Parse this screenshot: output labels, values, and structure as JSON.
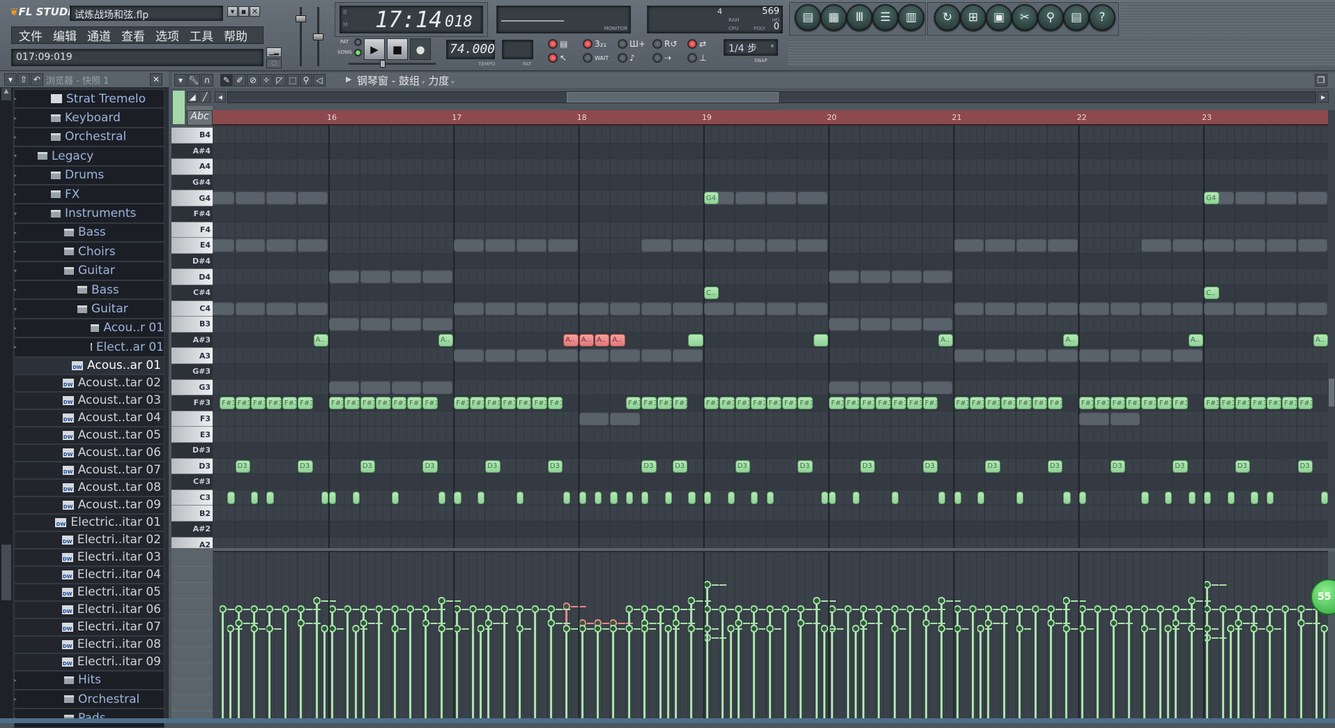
{
  "app": {
    "logo": "FL STUDIO",
    "title": "试炼战场和弦.flp"
  },
  "menu": [
    "文件",
    "编辑",
    "通道",
    "查看",
    "选项",
    "工具",
    "帮助"
  ],
  "hint": "017:09:019",
  "transport": {
    "time_main": "17:14",
    "time_sub": "018",
    "time_labels": [
      "B",
      "M"
    ],
    "monitor_label": "MONITOR",
    "pat_label": "PAT",
    "song_label": "SONG",
    "mode": "SONG",
    "tempo": "74.000",
    "tempo_label": "TEMPO",
    "pat_label2": "PAT"
  },
  "meters": {
    "value1": "4",
    "ram": "569",
    "ram_label": "RAM",
    "hd_label": "HD",
    "cpu_label": "CPU",
    "poly_label": "POLY",
    "poly": "0"
  },
  "toggles": {
    "row1": [
      {
        "icon": "pattern-icon",
        "glyph": "▤",
        "led": "red"
      },
      {
        "icon": "countdown-icon",
        "glyph": "3₂₁",
        "led": "red"
      },
      {
        "icon": "step-edit-icon",
        "glyph": "Ш+",
        "led": "off"
      },
      {
        "icon": "loop-record-icon",
        "glyph": "R↺",
        "led": "off"
      },
      {
        "icon": "blend-icon",
        "glyph": "⇄",
        "led": "red"
      }
    ],
    "row2": [
      {
        "icon": "metronome-icon",
        "glyph": "↖",
        "led": "red"
      },
      {
        "icon": "wait-icon",
        "glyph": "WAIT",
        "led": "off"
      },
      {
        "icon": "note-icon",
        "glyph": "♪",
        "led": "off"
      },
      {
        "icon": "scroll-icon",
        "glyph": "⇢",
        "led": "off"
      },
      {
        "icon": "typing-icon",
        "glyph": "⊥",
        "led": "off"
      }
    ]
  },
  "snap": {
    "value": "1/4 步",
    "label": "SNAP"
  },
  "window_buttons": [
    {
      "icon": "playlist-icon",
      "glyph": "▤"
    },
    {
      "icon": "step-sequencer-icon",
      "glyph": "▦"
    },
    {
      "icon": "piano-roll-icon",
      "glyph": "Ⅲ"
    },
    {
      "icon": "browser-icon",
      "glyph": "☰"
    },
    {
      "icon": "mixer-icon",
      "glyph": "▥"
    }
  ],
  "file_buttons": [
    {
      "icon": "undo-icon",
      "glyph": "↻"
    },
    {
      "icon": "save-new-icon",
      "glyph": "⊞"
    },
    {
      "icon": "save-icon",
      "glyph": "▣"
    },
    {
      "icon": "cut-icon",
      "glyph": "✂"
    },
    {
      "icon": "search-icon",
      "glyph": "⚲"
    },
    {
      "icon": "document-icon",
      "glyph": "▤"
    },
    {
      "icon": "help-icon",
      "glyph": "?"
    }
  ],
  "browser": {
    "title": "浏览器 - 快照 1",
    "items": [
      {
        "label": "Strat Tremelo",
        "type": "sample",
        "level": 2
      },
      {
        "label": "Keyboard",
        "type": "folder",
        "level": 2
      },
      {
        "label": "Orchestral",
        "type": "folder",
        "level": 2
      },
      {
        "label": "Legacy",
        "type": "folder",
        "level": 1,
        "open": true
      },
      {
        "label": "Drums",
        "type": "folder",
        "level": 2
      },
      {
        "label": "FX",
        "type": "folder",
        "level": 2
      },
      {
        "label": "Instruments",
        "type": "folder",
        "level": 2,
        "open": true
      },
      {
        "label": "Bass",
        "type": "folder",
        "level": 3
      },
      {
        "label": "Choirs",
        "type": "folder",
        "level": 3
      },
      {
        "label": "Guitar",
        "type": "folder",
        "level": 3,
        "open": true
      },
      {
        "label": "Bass",
        "type": "folder",
        "level": 4
      },
      {
        "label": "Guitar",
        "type": "folder",
        "level": 4,
        "open": true
      },
      {
        "label": "Acou..r 01",
        "type": "folder",
        "level": 5
      },
      {
        "label": "Elect..ar 01",
        "type": "folder",
        "level": 5
      },
      {
        "label": "Acous..ar 01",
        "type": "file",
        "selected": true
      },
      {
        "label": "Acoust..tar 02",
        "type": "file"
      },
      {
        "label": "Acoust..tar 03",
        "type": "file"
      },
      {
        "label": "Acoust..tar 04",
        "type": "file"
      },
      {
        "label": "Acoust..tar 05",
        "type": "file"
      },
      {
        "label": "Acoust..tar 06",
        "type": "file"
      },
      {
        "label": "Acoust..tar 07",
        "type": "file"
      },
      {
        "label": "Acoust..tar 08",
        "type": "file"
      },
      {
        "label": "Acoust..tar 09",
        "type": "file"
      },
      {
        "label": "Electric..itar 01",
        "type": "file"
      },
      {
        "label": "Electri..itar 02",
        "type": "file"
      },
      {
        "label": "Electri..itar 03",
        "type": "file"
      },
      {
        "label": "Electri..itar 04",
        "type": "file"
      },
      {
        "label": "Electri..itar 05",
        "type": "file"
      },
      {
        "label": "Electri..itar 06",
        "type": "file"
      },
      {
        "label": "Electri..itar 07",
        "type": "file"
      },
      {
        "label": "Electri..itar 08",
        "type": "file"
      },
      {
        "label": "Electri..itar 09",
        "type": "file"
      },
      {
        "label": "Hits",
        "type": "folder",
        "level": 3
      },
      {
        "label": "Orchestral",
        "type": "folder",
        "level": 3
      },
      {
        "label": "Pads",
        "type": "folder",
        "level": 3
      }
    ]
  },
  "piano_roll": {
    "title": "钢琴窗",
    "separator": "-",
    "channel": "鼓组",
    "target": "力度",
    "abc": "Abc",
    "keys": [
      "B4",
      "A#4",
      "A4",
      "G#4",
      "G4",
      "F#4",
      "F4",
      "E4",
      "D#4",
      "D4",
      "C#4",
      "C4",
      "B3",
      "A#3",
      "A3",
      "G#3",
      "G3",
      "F#3",
      "F3",
      "E3",
      "D#3",
      "D3",
      "C#3",
      "C3",
      "B2",
      "A#2",
      "A2"
    ],
    "ruler": [
      16,
      17,
      18,
      19,
      20,
      21,
      22,
      23
    ],
    "ghost_notes": [
      {
        "pitch": "G4",
        "bars": [
          15,
          19,
          23
        ]
      },
      {
        "pitch": "E4",
        "bars": [
          15,
          17,
          19,
          21,
          23
        ]
      },
      {
        "pitch": "E4",
        "bars": [
          18,
          22
        ],
        "beats": [
          2,
          3
        ]
      },
      {
        "pitch": "D4",
        "bars": [
          16,
          20
        ]
      },
      {
        "pitch": "C4",
        "bars": [
          15,
          17,
          18,
          19,
          21,
          22,
          23
        ]
      },
      {
        "pitch": "B3",
        "bars": [
          16,
          20
        ]
      },
      {
        "pitch": "A3",
        "bars": [
          17,
          18,
          21,
          22
        ]
      },
      {
        "pitch": "G3",
        "bars": [
          16,
          20
        ]
      },
      {
        "pitch": "F3",
        "bars": [
          18,
          22
        ],
        "beats": [
          0,
          1
        ]
      }
    ],
    "notes": [
      {
        "pitch": "G4",
        "label": "G4",
        "bars": [
          19,
          23
        ],
        "steps": [
          0
        ],
        "len": 2,
        "velocity": 0.97
      },
      {
        "pitch": "C#4",
        "label": "C..",
        "bars": [
          19,
          23
        ],
        "steps": [
          0
        ],
        "len": 2,
        "velocity": 0.6
      },
      {
        "pitch": "A#3",
        "label": "A..",
        "bars": [
          15,
          16,
          20,
          21,
          22,
          23
        ],
        "steps": [
          14
        ],
        "len": 2,
        "velocity": 0.86
      },
      {
        "pitch": "A#3",
        "label": "",
        "bars": [
          18,
          19
        ],
        "steps": [
          14
        ],
        "len": 2,
        "velocity": 0.86
      },
      {
        "pitch": "A#3",
        "label": "A..",
        "bars": [
          17
        ],
        "steps": [
          14
        ],
        "len": 2,
        "selected": true,
        "velocity": 0.82
      },
      {
        "pitch": "A#3",
        "label": "A..",
        "bars": [
          18
        ],
        "steps": [
          0,
          2,
          4
        ],
        "len": 2,
        "selected": true,
        "velocity": 0.7
      },
      {
        "pitch": "F#3",
        "label": "F#3",
        "bars": [
          15
        ],
        "steps": [
          2,
          4,
          6,
          8,
          10,
          12
        ],
        "len": 2,
        "velocity": 0.8
      },
      {
        "pitch": "F#3",
        "label": "F#3",
        "bars": [
          16,
          17,
          19,
          20,
          21,
          22,
          23
        ],
        "steps": [
          0,
          2,
          4,
          6,
          8,
          10,
          12
        ],
        "len": 2,
        "velocity": 0.8
      },
      {
        "pitch": "F#3",
        "label": "F#3",
        "bars": [
          18
        ],
        "steps": [
          6,
          8,
          10,
          12
        ],
        "len": 2,
        "velocity": 0.8
      },
      {
        "pitch": "D3",
        "label": "D3",
        "bars": [
          15,
          16,
          17,
          19,
          20,
          21,
          22,
          23
        ],
        "steps": [
          4,
          12
        ],
        "len": 2,
        "velocity": 0.7
      },
      {
        "pitch": "D3",
        "label": "D3",
        "bars": [
          18
        ],
        "steps": [
          8,
          12
        ],
        "len": 2,
        "velocity": 0.7
      },
      {
        "pitch": "C3",
        "label": "C3",
        "bars": [
          15
        ],
        "steps": [
          3,
          6,
          8,
          15
        ],
        "len": 1,
        "velocity": 0.66
      },
      {
        "pitch": "C3",
        "label": "C3",
        "bars": [
          16,
          17,
          20,
          21
        ],
        "steps": [
          0,
          3,
          8,
          14
        ],
        "len": 1,
        "velocity": 0.66
      },
      {
        "pitch": "C3",
        "label": "C3",
        "bars": [
          18
        ],
        "steps": [
          0,
          2,
          4,
          6,
          8,
          11,
          14
        ],
        "len": 1,
        "velocity": 0.66
      },
      {
        "pitch": "C3",
        "label": "C3",
        "bars": [
          19
        ],
        "steps": [
          0,
          3,
          6,
          8,
          15
        ],
        "len": 1,
        "velocity": 0.66
      },
      {
        "pitch": "C3",
        "label": "C3",
        "bars": [
          22
        ],
        "steps": [
          0,
          8,
          11,
          14
        ],
        "len": 1,
        "velocity": 0.66
      },
      {
        "pitch": "C3",
        "label": "C3",
        "bars": [
          23
        ],
        "steps": [
          0,
          3,
          6,
          8,
          15
        ],
        "len": 1,
        "velocity": 0.66
      }
    ]
  },
  "velocity_badge": "55",
  "colors": {
    "note": "#a9e2ac",
    "selected_note": "#e88a8a",
    "ruler": "#8c4a4f",
    "ghost": "#59616b"
  }
}
